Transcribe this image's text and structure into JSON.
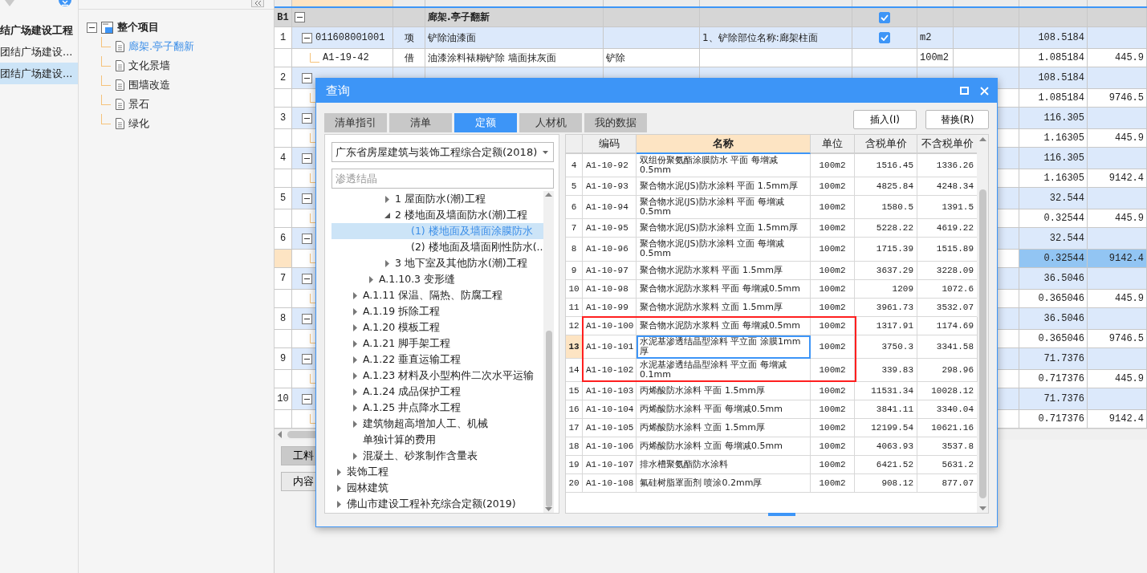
{
  "sidebar": {
    "items": [
      {
        "label": "结广场建设工程",
        "kind": "project",
        "selected": false
      },
      {
        "label": "团结广场建设...",
        "kind": "unit",
        "selected": false
      },
      {
        "label": "团结广场建设...",
        "kind": "unit",
        "selected": true
      }
    ]
  },
  "project_tree": {
    "label": "整个项目",
    "expanded": true,
    "children": [
      {
        "label": "廊架.亭子翻新",
        "selected": true
      },
      {
        "label": "文化景墙",
        "selected": false
      },
      {
        "label": "围墙改造",
        "selected": false
      },
      {
        "label": "景石",
        "selected": false
      },
      {
        "label": "绿化",
        "selected": false
      }
    ]
  },
  "grid": {
    "group": {
      "num": "B1",
      "name": "廊架.亭子翻新",
      "expanded": true,
      "locked": true
    },
    "rows": [
      {
        "kind": "list",
        "num": "1",
        "code": "011608001001",
        "type": "项",
        "name": "铲除油漆面",
        "feature": "1、铲除部位名称:廊架柱面",
        "locked": true,
        "unit": "m2",
        "qty": "108.5184",
        "selected": false
      },
      {
        "kind": "quota",
        "code": "A1-19-42",
        "type": "借",
        "name": "油漆涂料裱糊铲除 墙面抹灰面",
        "work": "铲除",
        "unit": "100m2",
        "qty": "1.085184",
        "price": "445.9",
        "selected": false
      },
      {
        "kind": "list",
        "num": "2",
        "qty": "108.5184",
        "selected": false
      },
      {
        "kind": "quota",
        "qty": "1.085184",
        "price": "9746.5",
        "selected": false
      },
      {
        "kind": "list",
        "num": "3",
        "qty": "116.305",
        "selected": false
      },
      {
        "kind": "quota",
        "qty": "1.16305",
        "price": "445.9",
        "selected": false
      },
      {
        "kind": "list",
        "num": "4",
        "qty": "116.305",
        "selected": false
      },
      {
        "kind": "quota",
        "qty": "1.16305",
        "price": "9142.4",
        "selected": false
      },
      {
        "kind": "list",
        "num": "5",
        "qty": "32.544",
        "selected": false
      },
      {
        "kind": "quota",
        "qty": "0.32544",
        "price": "445.9",
        "selected": false
      },
      {
        "kind": "list",
        "num": "6",
        "qty": "32.544",
        "selected": false
      },
      {
        "kind": "quota",
        "qty": "0.32544",
        "price": "9142.4",
        "selected": true
      },
      {
        "kind": "list",
        "num": "7",
        "qty": "36.5046",
        "selected": false
      },
      {
        "kind": "quota",
        "qty": "0.365046",
        "price": "445.9",
        "selected": false
      },
      {
        "kind": "list",
        "num": "8",
        "qty": "36.5046",
        "selected": false
      },
      {
        "kind": "quota",
        "qty": "0.365046",
        "price": "9746.5",
        "selected": false
      },
      {
        "kind": "list",
        "num": "9",
        "qty": "71.7376",
        "selected": false
      },
      {
        "kind": "quota",
        "qty": "0.717376",
        "price": "445.9",
        "selected": false
      },
      {
        "kind": "list",
        "num": "10",
        "qty": "71.7376",
        "selected": false
      },
      {
        "kind": "quota",
        "qty": "0.717376",
        "price": "9142.4",
        "selected": false
      }
    ]
  },
  "bottom_tabs": [
    {
      "label": "工料",
      "selected": true
    },
    {
      "label": "内容",
      "selected": false
    }
  ],
  "dialog": {
    "title": "查询",
    "tabs": [
      {
        "label": "清单指引",
        "selected": false
      },
      {
        "label": "清单",
        "selected": false
      },
      {
        "label": "定额",
        "selected": true
      },
      {
        "label": "人材机",
        "selected": false
      },
      {
        "label": "我的数据",
        "selected": false
      }
    ],
    "buttons": [
      "插入(I)",
      "替换(R)"
    ],
    "library": {
      "value": "广东省房屋建筑与装饰工程综合定额(2018)"
    },
    "search": {
      "placeholder": "渗透结晶"
    },
    "tree": [
      {
        "children": [
          {
            "children": [
              {
                "children": [
                  {
                    "label": "1 屋面防水(潮)工程",
                    "expanded": false,
                    "selected": false
                  },
                  {
                    "label": "2 楼地面及墙面防水(潮)工程",
                    "expanded": true,
                    "selected": false,
                    "children": [
                      {
                        "label": "(1) 楼地面及墙面涂膜防水",
                        "selected": true
                      },
                      {
                        "label": "(2) 楼地面及墙面刚性防水(...",
                        "selected": false
                      }
                    ]
                  },
                  {
                    "label": "3 地下室及其他防水(潮)工程",
                    "expanded": false,
                    "selected": false
                  }
                ]
              },
              {
                "label": "A.1.10.3 变形缝",
                "expanded": false,
                "selected": false
              }
            ]
          },
          {
            "label": "A.1.11 保温、隔热、防腐工程",
            "expanded": false,
            "selected": false
          },
          {
            "label": "A.1.19 拆除工程",
            "expanded": false,
            "selected": false
          },
          {
            "label": "A.1.20 模板工程",
            "expanded": false,
            "selected": false
          },
          {
            "label": "A.1.21 脚手架工程",
            "expanded": false,
            "selected": false
          },
          {
            "label": "A.1.22 垂直运输工程",
            "expanded": false,
            "selected": false
          },
          {
            "label": "A.1.23 材料及小型构件二次水平运输",
            "expanded": false,
            "selected": false
          },
          {
            "label": "A.1.24 成品保护工程",
            "expanded": false,
            "selected": false
          },
          {
            "label": "A.1.25 井点降水工程",
            "expanded": false,
            "selected": false
          },
          {
            "label": "建筑物超高增加人工、机械",
            "expanded": false,
            "selected": false
          },
          {
            "label": "单独计算的费用",
            "selected": false
          },
          {
            "label": "混凝土、砂浆制作含量表",
            "expanded": false,
            "selected": false
          }
        ]
      },
      {
        "label": "装饰工程",
        "expanded": false,
        "selected": false
      },
      {
        "label": "园林建筑",
        "expanded": false,
        "selected": false
      },
      {
        "label": "佛山市建设工程补充综合定额(2019)",
        "expanded": false,
        "selected": false
      }
    ],
    "table": {
      "columns": [
        {
          "label": "编码",
          "highlighted": false
        },
        {
          "label": "名称",
          "highlighted": true
        },
        {
          "label": "单位",
          "highlighted": false
        },
        {
          "label": "含税单价",
          "highlighted": false
        },
        {
          "label": "不含税单价",
          "highlighted": false
        }
      ],
      "rows": [
        {
          "num": "4",
          "code": "A1-10-92",
          "name": "双组份聚氨酯涂膜防水 平面 每增减0.5mm",
          "unit": "100m2",
          "price_tax": "1516.45",
          "price_net": "1336.26",
          "selected": false,
          "marked": false
        },
        {
          "num": "5",
          "code": "A1-10-93",
          "name": "聚合物水泥(JS)防水涂料 平面 1.5mm厚",
          "unit": "100m2",
          "price_tax": "4825.84",
          "price_net": "4248.34",
          "selected": false,
          "marked": false
        },
        {
          "num": "6",
          "code": "A1-10-94",
          "name": "聚合物水泥(JS)防水涂料 平面 每增减0.5mm",
          "unit": "100m2",
          "price_tax": "1580.5",
          "price_net": "1391.5",
          "selected": false,
          "marked": false
        },
        {
          "num": "7",
          "code": "A1-10-95",
          "name": "聚合物水泥(JS)防水涂料 立面 1.5mm厚",
          "unit": "100m2",
          "price_tax": "5228.22",
          "price_net": "4619.22",
          "selected": false,
          "marked": false
        },
        {
          "num": "8",
          "code": "A1-10-96",
          "name": "聚合物水泥(JS)防水涂料 立面 每增减0.5mm",
          "unit": "100m2",
          "price_tax": "1715.39",
          "price_net": "1515.89",
          "selected": false,
          "marked": false
        },
        {
          "num": "9",
          "code": "A1-10-97",
          "name": "聚合物水泥防水浆料 平面 1.5mm厚",
          "unit": "100m2",
          "price_tax": "3637.29",
          "price_net": "3228.09",
          "selected": false,
          "marked": false
        },
        {
          "num": "10",
          "code": "A1-10-98",
          "name": "聚合物水泥防水浆料 平面 每增减0.5mm",
          "unit": "100m2",
          "price_tax": "1209",
          "price_net": "1072.6",
          "selected": false,
          "marked": false
        },
        {
          "num": "11",
          "code": "A1-10-99",
          "name": "聚合物水泥防水浆料 立面 1.5mm厚",
          "unit": "100m2",
          "price_tax": "3961.73",
          "price_net": "3532.07",
          "selected": false,
          "marked": false
        },
        {
          "num": "12",
          "code": "A1-10-100",
          "name": "聚合物水泥防水浆料 立面 每增减0.5mm",
          "unit": "100m2",
          "price_tax": "1317.91",
          "price_net": "1174.69",
          "selected": false,
          "marked": true
        },
        {
          "num": "13",
          "code": "A1-10-101",
          "name": "水泥基渗透结晶型涂料 平立面 涂膜1mm厚",
          "unit": "100m2",
          "price_tax": "3750.3",
          "price_net": "3341.58",
          "selected": true,
          "marked": true
        },
        {
          "num": "14",
          "code": "A1-10-102",
          "name": "水泥基渗透结晶型涂料 平立面 每增减0.1mm",
          "unit": "100m2",
          "price_tax": "339.83",
          "price_net": "298.96",
          "selected": false,
          "marked": true
        },
        {
          "num": "15",
          "code": "A1-10-103",
          "name": "丙烯酸防水涂料 平面 1.5mm厚",
          "unit": "100m2",
          "price_tax": "11531.34",
          "price_net": "10028.12",
          "selected": false,
          "marked": false
        },
        {
          "num": "16",
          "code": "A1-10-104",
          "name": "丙烯酸防水涂料 平面 每增减0.5mm",
          "unit": "100m2",
          "price_tax": "3841.11",
          "price_net": "3340.04",
          "selected": false,
          "marked": false
        },
        {
          "num": "17",
          "code": "A1-10-105",
          "name": "丙烯酸防水涂料 立面 1.5mm厚",
          "unit": "100m2",
          "price_tax": "12199.54",
          "price_net": "10621.16",
          "selected": false,
          "marked": false
        },
        {
          "num": "18",
          "code": "A1-10-106",
          "name": "丙烯酸防水涂料 立面 每增减0.5mm",
          "unit": "100m2",
          "price_tax": "4063.93",
          "price_net": "3537.8",
          "selected": false,
          "marked": false
        },
        {
          "num": "19",
          "code": "A1-10-107",
          "name": "排水槽聚氨酯防水涂料",
          "unit": "100m2",
          "price_tax": "6421.52",
          "price_net": "5631.2",
          "selected": false,
          "marked": false
        },
        {
          "num": "20",
          "code": "A1-10-108",
          "name": "氟硅树脂罩面剂 喷涂0.2mm厚",
          "unit": "100m2",
          "price_tax": "908.12",
          "price_net": "877.07",
          "selected": false,
          "marked": false
        }
      ]
    }
  }
}
